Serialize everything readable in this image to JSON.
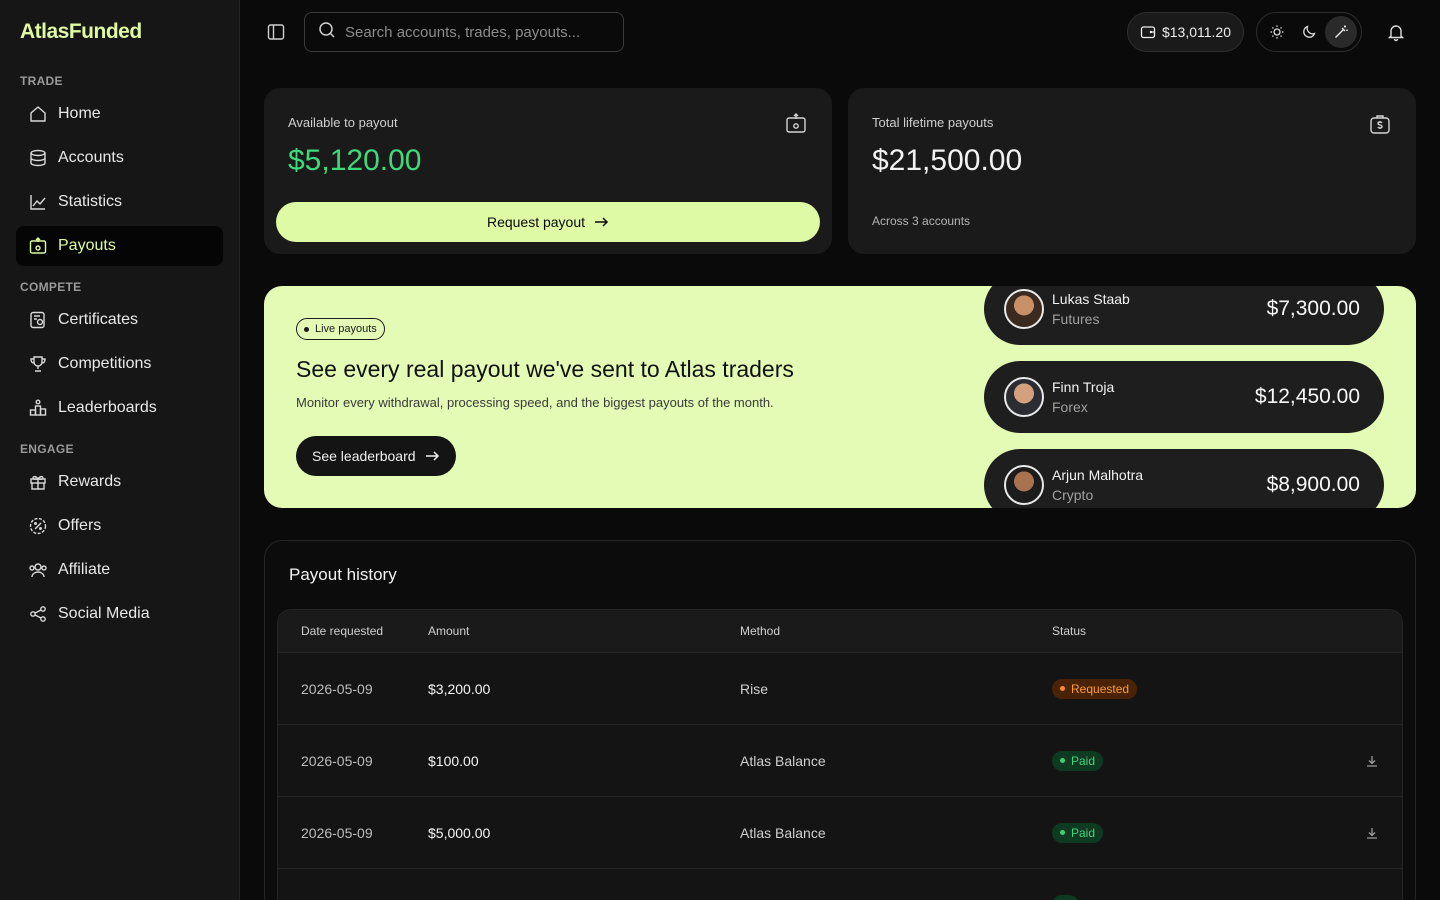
{
  "brand": {
    "name": "AtlasFunded"
  },
  "sidebar": {
    "sections": [
      {
        "label": "TRADE",
        "items": [
          {
            "label": "Home",
            "icon": "home-icon"
          },
          {
            "label": "Accounts",
            "icon": "database-icon"
          },
          {
            "label": "Statistics",
            "icon": "chart-line-icon"
          },
          {
            "label": "Payouts",
            "icon": "payout-icon",
            "active": true
          }
        ]
      },
      {
        "label": "COMPETE",
        "items": [
          {
            "label": "Certificates",
            "icon": "certificate-icon"
          },
          {
            "label": "Competitions",
            "icon": "trophy-icon"
          },
          {
            "label": "Leaderboards",
            "icon": "podium-icon"
          }
        ]
      },
      {
        "label": "ENGAGE",
        "items": [
          {
            "label": "Rewards",
            "icon": "gift-icon"
          },
          {
            "label": "Offers",
            "icon": "discount-icon"
          },
          {
            "label": "Affiliate",
            "icon": "users-icon"
          },
          {
            "label": "Social Media",
            "icon": "share-icon"
          }
        ]
      }
    ]
  },
  "topbar": {
    "search_placeholder": "Search accounts, trades, payouts...",
    "balance": "$13,011.20",
    "theme_options": [
      "light",
      "dark",
      "auto"
    ],
    "theme_active": "auto"
  },
  "cards": {
    "available": {
      "label": "Available to payout",
      "value": "$5,120.00",
      "button": "Request payout"
    },
    "lifetime": {
      "label": "Total lifetime payouts",
      "value": "$21,500.00",
      "sub": "Across 3 accounts"
    }
  },
  "banner": {
    "badge": "Live payouts",
    "title": "See every real payout we've sent to Atlas traders",
    "description": "Monitor every withdrawal, processing speed, and the biggest payouts of the month.",
    "button": "See leaderboard",
    "payouts": [
      {
        "name": "Lukas Staab",
        "type": "Futures",
        "amount": "$7,300.00"
      },
      {
        "name": "Finn Troja",
        "type": "Forex",
        "amount": "$12,450.00"
      },
      {
        "name": "Arjun Malhotra",
        "type": "Crypto",
        "amount": "$8,900.00"
      }
    ]
  },
  "history": {
    "title": "Payout history",
    "columns": {
      "date": "Date requested",
      "amount": "Amount",
      "method": "Method",
      "status": "Status"
    },
    "rows": [
      {
        "date": "2026-05-09",
        "amount": "$3,200.00",
        "method": "Rise",
        "status": "Requested"
      },
      {
        "date": "2026-05-09",
        "amount": "$100.00",
        "method": "Atlas Balance",
        "status": "Paid"
      },
      {
        "date": "2026-05-09",
        "amount": "$5,000.00",
        "method": "Atlas Balance",
        "status": "Paid"
      }
    ]
  },
  "colors": {
    "accent": "#dffaa4",
    "green": "#3fd97c",
    "requested": "#fb8a2a",
    "paid": "#3fcf74"
  }
}
